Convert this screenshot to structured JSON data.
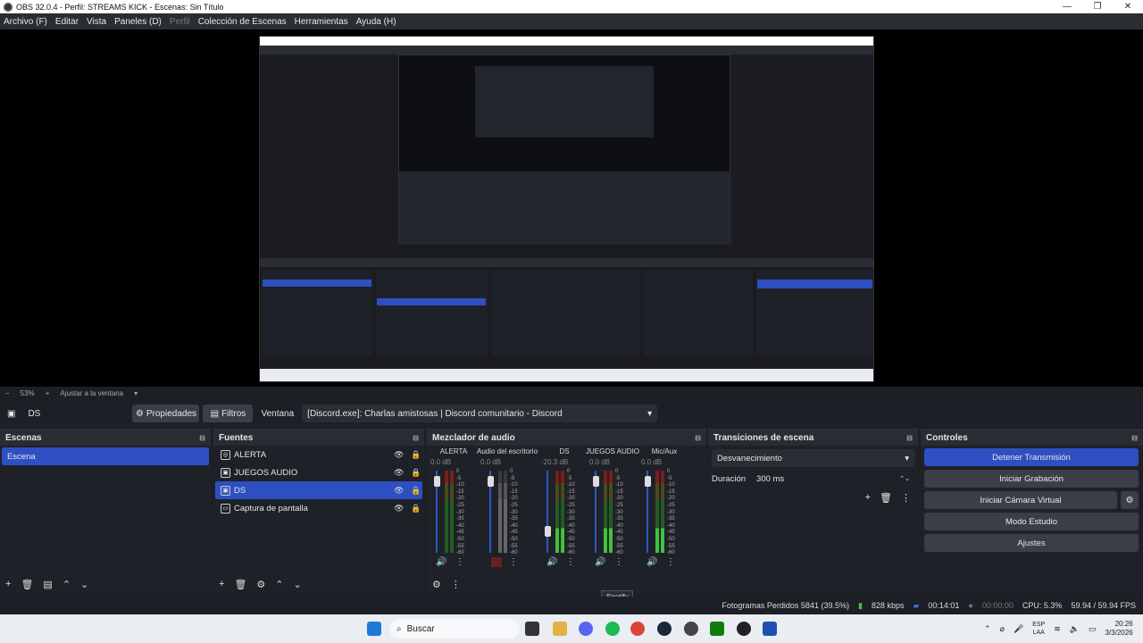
{
  "window": {
    "title": "OBS 32.0.4 - Perfil: STREAMS KICK - Escenas: Sin Título"
  },
  "menu": [
    "Archivo (F)",
    "Editar",
    "Vista",
    "Paneles (D)",
    "Perfil",
    "Colección de Escenas",
    "Herramientas",
    "Ayuda (H)"
  ],
  "zoom": {
    "level": "53%",
    "fit_label": "Ajustar a la ventana"
  },
  "source_bar": {
    "source": "DS",
    "properties": "Propiedades",
    "filters": "Filtros",
    "window_label": "Ventana",
    "window_value": "[Discord.exe]: Charlas amistosas | Discord comunitario - Discord"
  },
  "scenes": {
    "title": "Escenas",
    "items": [
      "Escena"
    ]
  },
  "sources": {
    "title": "Fuentes",
    "items": [
      "ALERTA",
      "JUEGOS AUDIO",
      "DS",
      "Captura de pantalla"
    ]
  },
  "mixer": {
    "title": "Mezclador de audio",
    "channels": [
      {
        "name": "ALERTA",
        "db": "0.0 dB"
      },
      {
        "name": "Audio del escritorio",
        "db": "0.0 dB"
      },
      {
        "name": "DS",
        "db": "-20.3 dB"
      },
      {
        "name": "JUEGOS AUDIO",
        "db": "0.0 dB"
      },
      {
        "name": "Mic/Aux",
        "db": "0.0 dB"
      }
    ],
    "scale": [
      "0",
      "-5",
      "-10",
      "-15",
      "-20",
      "-25",
      "-30",
      "-35",
      "-40",
      "-45",
      "-50",
      "-55",
      "-60"
    ]
  },
  "transitions": {
    "title": "Transiciones de escena",
    "selected": "Desvanecimiento",
    "duration_label": "Duración",
    "duration_value": "300 ms"
  },
  "controls": {
    "title": "Controles",
    "stop_stream": "Detener Transmisión",
    "start_record": "Iniciar Grabación",
    "virtual_cam": "Iniciar Cámara Virtual",
    "studio_mode": "Modo Estudio",
    "settings": "Ajustes"
  },
  "status": {
    "dropped": "Fotogramas Perdidos 5841 (39.5%)",
    "bitrate": "828 kbps",
    "stream_time": "00:14:01",
    "record_time": "00:00:00",
    "cpu": "CPU: 5.3%",
    "fps": "59.94 / 59.94 FPS"
  },
  "tooltip": "Spotify",
  "taskbar": {
    "search": "Buscar",
    "lang": "ESP",
    "lang2": "LAA",
    "time": "20:26",
    "date": "3/3/2026"
  }
}
